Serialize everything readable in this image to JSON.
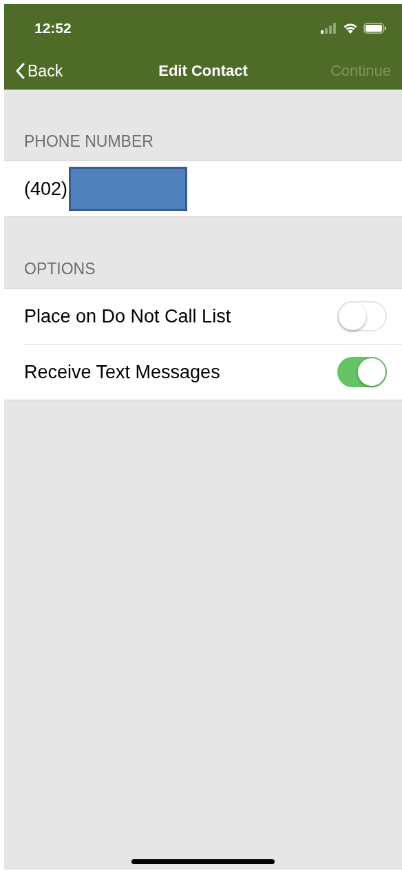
{
  "status_bar": {
    "time": "12:52"
  },
  "nav": {
    "back": "Back",
    "title": "Edit Contact",
    "action": {
      "label": "Continue",
      "disabled": true
    }
  },
  "sections": [
    {
      "header": "PHONE NUMBER",
      "rows": [
        {
          "kind": "phone",
          "value": "(402)",
          "redacted": true
        }
      ]
    },
    {
      "header": "OPTIONS",
      "rows": [
        {
          "kind": "toggle",
          "label": "Place on Do Not Call List",
          "on": false
        },
        {
          "kind": "toggle",
          "label": "Receive Text Messages",
          "on": true
        }
      ]
    }
  ]
}
